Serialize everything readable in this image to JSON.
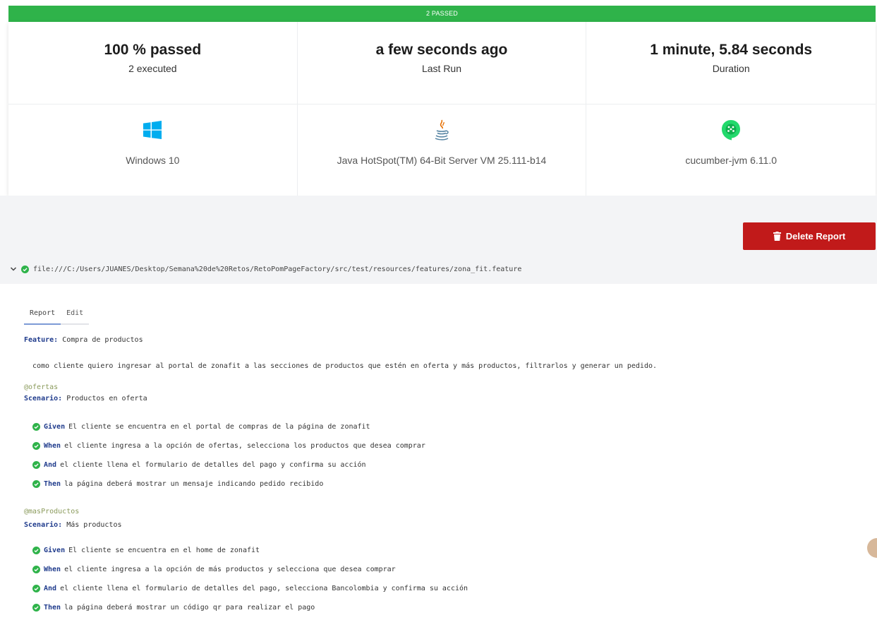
{
  "status_bar": {
    "label": "2 PASSED"
  },
  "summary": {
    "passed": {
      "value": "100 % passed",
      "label": "2 executed"
    },
    "last_run": {
      "value": "a few seconds ago",
      "label": "Last Run"
    },
    "duration": {
      "value": "1 minute, 5.84 seconds",
      "label": "Duration"
    }
  },
  "environment": {
    "os": {
      "icon": "windows-icon",
      "label": "Windows 10"
    },
    "runtime": {
      "icon": "java-icon",
      "label": "Java HotSpot(TM) 64-Bit Server VM 25.111-b14"
    },
    "framework": {
      "icon": "cucumber-icon",
      "label": "cucumber-jvm 6.11.0"
    }
  },
  "actions": {
    "delete_label": "Delete Report"
  },
  "feature_file": {
    "path": "file:///C:/Users/JUANES/Desktop/Semana%20de%20Retos/RetoPomPageFactory/src/test/resources/features/zona_fit.feature"
  },
  "tabs": [
    {
      "label": "Report",
      "active": true
    },
    {
      "label": "Edit",
      "active": false
    }
  ],
  "feature": {
    "keyword": "Feature:",
    "name": "Compra de productos",
    "description": "como cliente quiero ingresar al portal de zonafit a las secciones de productos que estén en oferta y más productos, filtrarlos y generar un pedido."
  },
  "scenarios": [
    {
      "tag": "@ofertas",
      "keyword": "Scenario:",
      "name": "Productos en oferta",
      "steps": [
        {
          "keyword": "Given",
          "text": "El cliente se encuentra en el portal de compras de la página de zonafit"
        },
        {
          "keyword": "When",
          "text": "el cliente ingresa a la opción de ofertas, selecciona los productos que desea comprar"
        },
        {
          "keyword": "And",
          "text": "el cliente llena el formulario de detalles del pago y confirma su acción"
        },
        {
          "keyword": "Then",
          "text": "la página deberá mostrar un mensaje indicando pedido recibido"
        }
      ]
    },
    {
      "tag": "@masProductos",
      "keyword": "Scenario:",
      "name": "Más productos",
      "steps": [
        {
          "keyword": "Given",
          "text": "El cliente se encuentra en el home de zonafit"
        },
        {
          "keyword": "When",
          "text": "el cliente ingresa a la opción de más productos y selecciona que desea comprar"
        },
        {
          "keyword": "And",
          "text": "el cliente llena el formulario de detalles del pago, selecciona Bancolombia y confirma su acción"
        },
        {
          "keyword": "Then",
          "text": "la página deberá mostrar un código qr para realizar el pago"
        }
      ]
    }
  ],
  "colors": {
    "passed": "#2fb34a",
    "danger": "#c11a1a",
    "keyword": "#1f3b8c",
    "tag": "#8a9a5b"
  }
}
